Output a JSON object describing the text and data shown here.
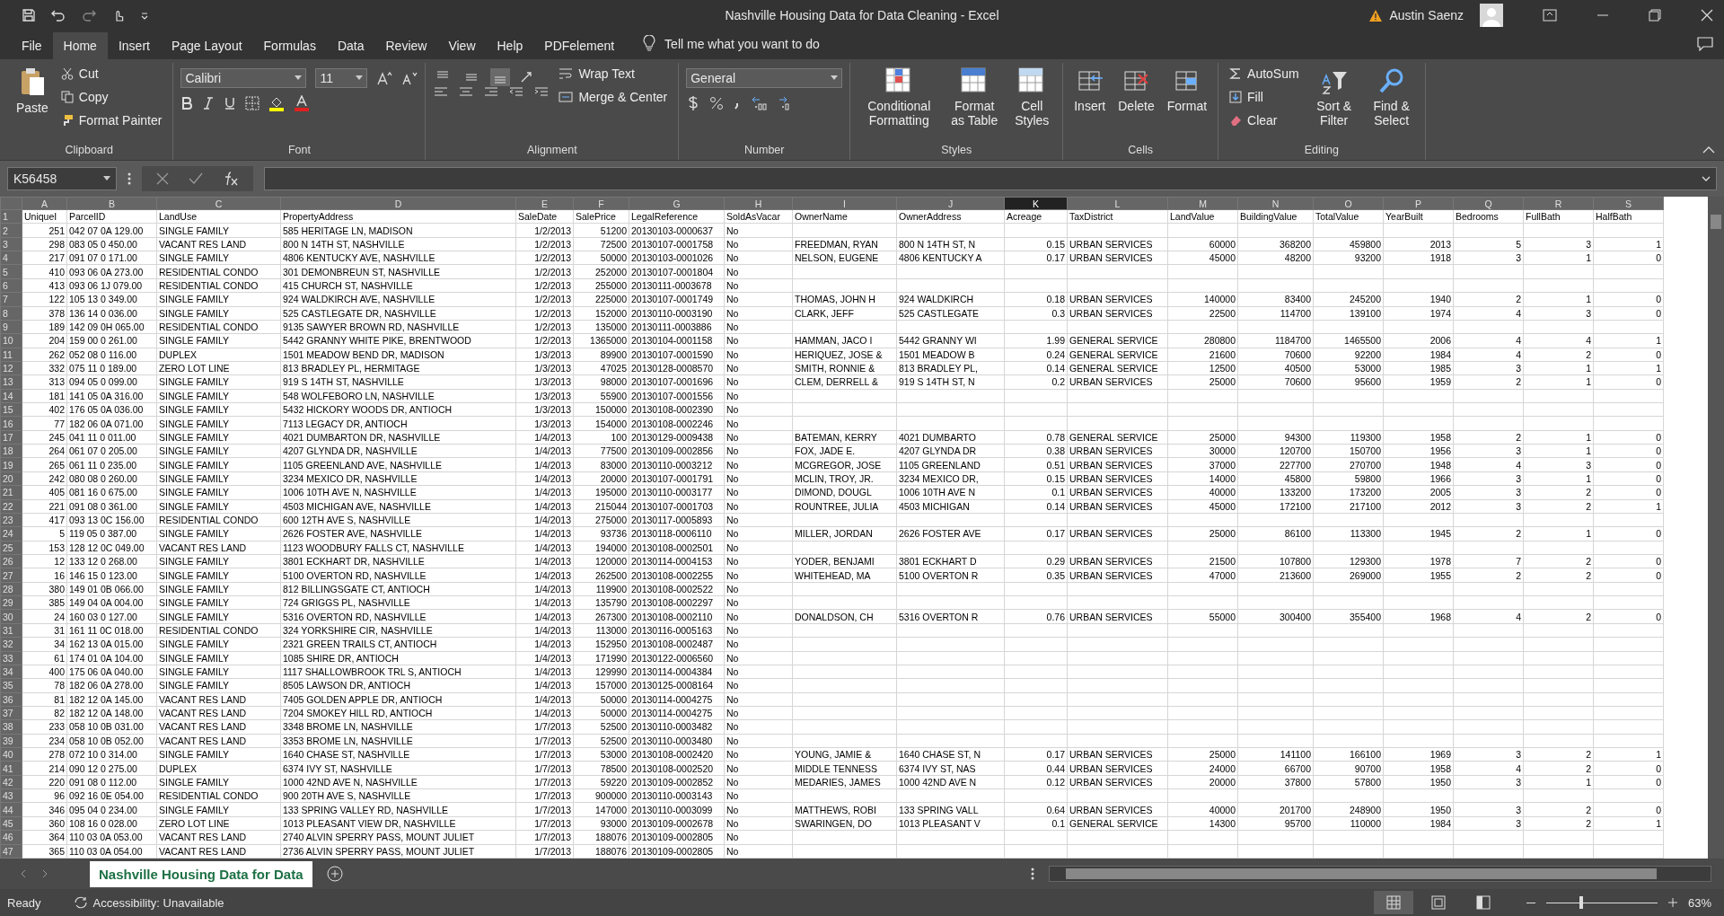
{
  "window": {
    "title": "Nashville Housing Data for Data Cleaning  -  Excel",
    "user": "Austin Saenz"
  },
  "menu_tabs": [
    {
      "label": "File",
      "selected": false
    },
    {
      "label": "Home",
      "selected": true
    },
    {
      "label": "Insert",
      "selected": false
    },
    {
      "label": "Page Layout",
      "selected": false
    },
    {
      "label": "Formulas",
      "selected": false
    },
    {
      "label": "Data",
      "selected": false
    },
    {
      "label": "Review",
      "selected": false
    },
    {
      "label": "View",
      "selected": false
    },
    {
      "label": "Help",
      "selected": false
    },
    {
      "label": "PDFelement",
      "selected": false
    }
  ],
  "tell_me": "Tell me what you want to do",
  "ribbon": {
    "clipboard": {
      "label": "Clipboard",
      "paste": "Paste",
      "cut": "Cut",
      "copy": "Copy",
      "format_painter": "Format Painter"
    },
    "font": {
      "label": "Font",
      "font_name": "Calibri",
      "font_size": "11"
    },
    "alignment": {
      "label": "Alignment",
      "wrap_text": "Wrap Text",
      "merge_center": "Merge & Center",
      "vertical_align": [
        {
          "selected": false
        },
        {
          "selected": false
        },
        {
          "selected": true
        }
      ]
    },
    "number": {
      "label": "Number",
      "format": "General"
    },
    "styles": {
      "label": "Styles",
      "buttons": [
        "Conditional Formatting",
        "Format as Table",
        "Cell Styles"
      ]
    },
    "cells": {
      "label": "Cells",
      "buttons": [
        "Insert",
        "Delete",
        "Format"
      ]
    },
    "editing": {
      "label": "Editing",
      "autosum": "AutoSum",
      "fill": "Fill",
      "clear": "Clear",
      "buttons": [
        "Sort & Filter",
        "Find & Select"
      ]
    }
  },
  "formula_bar": {
    "name_box": "K56458"
  },
  "columns": [
    {
      "letter": "A",
      "selected": false
    },
    {
      "letter": "B",
      "selected": false
    },
    {
      "letter": "C",
      "selected": false
    },
    {
      "letter": "D",
      "selected": false
    },
    {
      "letter": "E",
      "selected": false
    },
    {
      "letter": "F",
      "selected": false
    },
    {
      "letter": "G",
      "selected": false
    },
    {
      "letter": "H",
      "selected": false
    },
    {
      "letter": "I",
      "selected": false
    },
    {
      "letter": "J",
      "selected": false
    },
    {
      "letter": "K",
      "selected": true
    },
    {
      "letter": "L",
      "selected": false
    },
    {
      "letter": "M",
      "selected": false
    },
    {
      "letter": "N",
      "selected": false
    },
    {
      "letter": "O",
      "selected": false
    },
    {
      "letter": "P",
      "selected": false
    },
    {
      "letter": "Q",
      "selected": false
    },
    {
      "letter": "R",
      "selected": false
    },
    {
      "letter": "S",
      "selected": false
    }
  ],
  "rows": [
    {
      "row": "1",
      "cells": [
        "UniqueI",
        "ParcelID",
        "LandUse",
        "PropertyAddress",
        "SaleDate",
        "SalePrice",
        "LegalReference",
        "SoldAsVacar"
      ],
      "owner": [
        "OwnerName",
        "OwnerAddress",
        "Acreage",
        "TaxDistrict",
        "LandValue",
        "BuildingValue",
        "TotalValue",
        "YearBuilt",
        "Bedrooms",
        "FullBath",
        "HalfBath"
      ]
    },
    {
      "row": "2",
      "cells": [
        "251",
        "042 07 0A 129.00",
        "SINGLE FAMILY",
        "585  HERITAGE LN, MADISON",
        "1/2/2013",
        "51200",
        "20130103-0000637",
        "No"
      ]
    },
    {
      "row": "3",
      "cells": [
        "298",
        "083 05 0 450.00",
        "VACANT RES LAND",
        "800  N 14TH ST, NASHVILLE",
        "1/2/2013",
        "72500",
        "20130107-0001758",
        "No"
      ],
      "owner": [
        "FREEDMAN, RYAN",
        "800  N 14TH ST, N",
        "0.15",
        "URBAN SERVICES",
        "60000",
        "368200",
        "459800",
        "2013",
        "5",
        "3",
        "1"
      ]
    },
    {
      "row": "4",
      "cells": [
        "217",
        "091 07 0 171.00",
        "SINGLE FAMILY",
        "4806  KENTUCKY AVE, NASHVILLE",
        "1/2/2013",
        "50000",
        "20130103-0001026",
        "No"
      ],
      "owner": [
        "NELSON, EUGENE",
        "4806  KENTUCKY A",
        "0.17",
        "URBAN SERVICES",
        "45000",
        "48200",
        "93200",
        "1918",
        "3",
        "1",
        "0"
      ]
    },
    {
      "row": "5",
      "cells": [
        "410",
        "093 06 0A 273.00",
        "RESIDENTIAL CONDO",
        "301  DEMONBREUN ST, NASHVILLE",
        "1/2/2013",
        "252000",
        "20130107-0001804",
        "No"
      ]
    },
    {
      "row": "6",
      "cells": [
        "413",
        "093 06 1J 079.00",
        "RESIDENTIAL CONDO",
        "415  CHURCH ST, NASHVILLE",
        "1/2/2013",
        "255000",
        "20130111-0003678",
        "No"
      ]
    },
    {
      "row": "7",
      "cells": [
        "122",
        "105 13 0 349.00",
        "SINGLE FAMILY",
        "924  WALDKIRCH AVE, NASHVILLE",
        "1/2/2013",
        "225000",
        "20130107-0001749",
        "No"
      ],
      "owner": [
        "THOMAS, JOHN H",
        "924  WALDKIRCH",
        "0.18",
        "URBAN SERVICES",
        "140000",
        "83400",
        "245200",
        "1940",
        "2",
        "1",
        "0"
      ]
    },
    {
      "row": "8",
      "cells": [
        "378",
        "136 14 0 036.00",
        "SINGLE FAMILY",
        "525  CASTLEGATE DR, NASHVILLE",
        "1/2/2013",
        "152000",
        "20130110-0003190",
        "No"
      ],
      "owner": [
        "CLARK, JEFF",
        "525  CASTLEGATE",
        "0.3",
        "URBAN SERVICES",
        "22500",
        "114700",
        "139100",
        "1974",
        "4",
        "3",
        "0"
      ]
    },
    {
      "row": "9",
      "cells": [
        "189",
        "142 09 0H 065.00",
        "RESIDENTIAL CONDO",
        "9135  SAWYER BROWN RD, NASHVILLE",
        "1/2/2013",
        "135000",
        "20130111-0003886",
        "No"
      ]
    },
    {
      "row": "10",
      "cells": [
        "204",
        "159 00 0 261.00",
        "SINGLE FAMILY",
        "5442  GRANNY WHITE PIKE, BRENTWOOD",
        "1/2/2013",
        "1365000",
        "20130104-0001158",
        "No"
      ],
      "owner": [
        "HAMMAN, JACO I",
        "5442  GRANNY WI",
        "1.99",
        "GENERAL SERVICE",
        "280800",
        "1184700",
        "1465500",
        "2006",
        "4",
        "4",
        "1"
      ]
    },
    {
      "row": "11",
      "cells": [
        "262",
        "052 08 0 116.00",
        "DUPLEX",
        "1501  MEADOW BEND DR, MADISON",
        "1/3/2013",
        "89900",
        "20130107-0001590",
        "No"
      ],
      "owner": [
        "HERIQUEZ, JOSE &",
        "1501  MEADOW B",
        "0.24",
        "GENERAL SERVICE",
        "21600",
        "70600",
        "92200",
        "1984",
        "4",
        "2",
        "0"
      ]
    },
    {
      "row": "12",
      "cells": [
        "332",
        "075 11 0 189.00",
        "ZERO LOT LINE",
        "813  BRADLEY PL, HERMITAGE",
        "1/3/2013",
        "47025",
        "20130128-0008570",
        "No"
      ],
      "owner": [
        "SMITH, RONNIE &",
        "813  BRADLEY PL,",
        "0.14",
        "GENERAL SERVICE",
        "12500",
        "40500",
        "53000",
        "1985",
        "3",
        "1",
        "1"
      ]
    },
    {
      "row": "13",
      "cells": [
        "313",
        "094 05 0 099.00",
        "SINGLE FAMILY",
        "919  S 14TH ST, NASHVILLE",
        "1/3/2013",
        "98000",
        "20130107-0001696",
        "No"
      ],
      "owner": [
        "CLEM, DERRELL &",
        "919  S 14TH ST, N",
        "0.2",
        "URBAN SERVICES",
        "25000",
        "70600",
        "95600",
        "1959",
        "2",
        "1",
        "0"
      ]
    },
    {
      "row": "14",
      "cells": [
        "181",
        "141 05 0A 316.00",
        "SINGLE FAMILY",
        "548  WOLFEBORO LN, NASHVILLE",
        "1/3/2013",
        "55900",
        "20130107-0001556",
        "No"
      ]
    },
    {
      "row": "15",
      "cells": [
        "402",
        "176 05 0A 036.00",
        "SINGLE FAMILY",
        "5432  HICKORY WOODS DR, ANTIOCH",
        "1/3/2013",
        "150000",
        "20130108-0002390",
        "No"
      ]
    },
    {
      "row": "16",
      "cells": [
        "77",
        "182 06 0A 071.00",
        "SINGLE FAMILY",
        "7113  LEGACY DR, ANTIOCH",
        "1/3/2013",
        "154000",
        "20130108-0002246",
        "No"
      ]
    },
    {
      "row": "17",
      "cells": [
        "245",
        "041 11 0 011.00",
        "SINGLE FAMILY",
        "4021  DUMBARTON DR, NASHVILLE",
        "1/4/2013",
        "100",
        "20130129-0009438",
        "No"
      ],
      "owner": [
        "BATEMAN, KERRY",
        "4021  DUMBARTO",
        "0.78",
        "GENERAL SERVICE",
        "25000",
        "94300",
        "119300",
        "1958",
        "2",
        "1",
        "0"
      ]
    },
    {
      "row": "18",
      "cells": [
        "264",
        "061 07 0 205.00",
        "SINGLE FAMILY",
        "4207  GLYNDA DR, NASHVILLE",
        "1/4/2013",
        "77500",
        "20130109-0002856",
        "No"
      ],
      "owner": [
        "FOX, JADE E.",
        "4207  GLYNDA DR",
        "0.38",
        "URBAN SERVICES",
        "30000",
        "120700",
        "150700",
        "1956",
        "3",
        "1",
        "0"
      ]
    },
    {
      "row": "19",
      "cells": [
        "265",
        "061 11 0 235.00",
        "SINGLE FAMILY",
        "1105  GREENLAND AVE, NASHVILLE",
        "1/4/2013",
        "83000",
        "20130110-0003212",
        "No"
      ],
      "owner": [
        "MCGREGOR, JOSE",
        "1105  GREENLAND",
        "0.51",
        "URBAN SERVICES",
        "37000",
        "227700",
        "270700",
        "1948",
        "4",
        "3",
        "0"
      ]
    },
    {
      "row": "20",
      "cells": [
        "242",
        "080 08 0 260.00",
        "SINGLE FAMILY",
        "3234  MEXICO DR, NASHVILLE",
        "1/4/2013",
        "20000",
        "20130107-0001791",
        "No"
      ],
      "owner": [
        "MCLIN, TROY, JR.",
        "3234  MEXICO DR,",
        "0.15",
        "URBAN SERVICES",
        "14000",
        "45800",
        "59800",
        "1966",
        "3",
        "1",
        "0"
      ]
    },
    {
      "row": "21",
      "cells": [
        "405",
        "081 16 0 675.00",
        "SINGLE FAMILY",
        "1006  10TH AVE N, NASHVILLE",
        "1/4/2013",
        "195000",
        "20130110-0003177",
        "No"
      ],
      "owner": [
        "DIMOND, DOUGL",
        "1006  10TH AVE N",
        "0.1",
        "URBAN SERVICES",
        "40000",
        "133200",
        "173200",
        "2005",
        "3",
        "2",
        "0"
      ]
    },
    {
      "row": "22",
      "cells": [
        "221",
        "091 08 0 361.00",
        "SINGLE FAMILY",
        "4503  MICHIGAN AVE, NASHVILLE",
        "1/4/2013",
        "215044",
        "20130107-0001703",
        "No"
      ],
      "owner": [
        "ROUNTREE, JULIA",
        "4503  MICHIGAN",
        "0.14",
        "URBAN SERVICES",
        "45000",
        "172100",
        "217100",
        "2012",
        "3",
        "2",
        "1"
      ]
    },
    {
      "row": "23",
      "cells": [
        "417",
        "093 13 0C 156.00",
        "RESIDENTIAL CONDO",
        "600  12TH AVE S, NASHVILLE",
        "1/4/2013",
        "275000",
        "20130117-0005893",
        "No"
      ]
    },
    {
      "row": "24",
      "cells": [
        "5",
        "119 05 0 387.00",
        "SINGLE FAMILY",
        "2626  FOSTER AVE, NASHVILLE",
        "1/4/2013",
        "93736",
        "20130118-0006110",
        "No"
      ],
      "owner": [
        "MILLER, JORDAN",
        "2626  FOSTER AVE",
        "0.17",
        "URBAN SERVICES",
        "25000",
        "86100",
        "113300",
        "1945",
        "2",
        "1",
        "0"
      ]
    },
    {
      "row": "25",
      "cells": [
        "153",
        "128 12 0C 049.00",
        "VACANT RES LAND",
        "1123  WOODBURY FALLS CT, NASHVILLE",
        "1/4/2013",
        "194000",
        "20130108-0002501",
        "No"
      ]
    },
    {
      "row": "26",
      "cells": [
        "12",
        "133 12 0 268.00",
        "SINGLE FAMILY",
        "3801  ECKHART DR, NASHVILLE",
        "1/4/2013",
        "120000",
        "20130114-0004153",
        "No"
      ],
      "owner": [
        "YODER, BENJAMI",
        "3801  ECKHART D",
        "0.29",
        "URBAN SERVICES",
        "21500",
        "107800",
        "129300",
        "1978",
        "7",
        "2",
        "0"
      ]
    },
    {
      "row": "27",
      "cells": [
        "16",
        "146 15 0 123.00",
        "SINGLE FAMILY",
        "5100  OVERTON RD, NASHVILLE",
        "1/4/2013",
        "262500",
        "20130108-0002255",
        "No"
      ],
      "owner": [
        "WHITEHEAD, MA",
        "5100  OVERTON R",
        "0.35",
        "URBAN SERVICES",
        "47000",
        "213600",
        "269000",
        "1955",
        "2",
        "2",
        "0"
      ]
    },
    {
      "row": "28",
      "cells": [
        "380",
        "149 01 0B 066.00",
        "SINGLE FAMILY",
        "812  BILLINGSGATE CT, ANTIOCH",
        "1/4/2013",
        "119900",
        "20130108-0002522",
        "No"
      ]
    },
    {
      "row": "29",
      "cells": [
        "385",
        "149 04 0A 004.00",
        "SINGLE FAMILY",
        "724  GRIGGS PL, NASHVILLE",
        "1/4/2013",
        "135790",
        "20130108-0002297",
        "No"
      ]
    },
    {
      "row": "30",
      "cells": [
        "24",
        "160 03 0 127.00",
        "SINGLE FAMILY",
        "5316  OVERTON RD, NASHVILLE",
        "1/4/2013",
        "267300",
        "20130108-0002110",
        "No"
      ],
      "owner": [
        "DONALDSON, CH",
        "5316  OVERTON R",
        "0.76",
        "URBAN SERVICES",
        "55000",
        "300400",
        "355400",
        "1968",
        "4",
        "2",
        "0"
      ]
    },
    {
      "row": "31",
      "cells": [
        "31",
        "161 11 0C 018.00",
        "RESIDENTIAL CONDO",
        "324  YORKSHIRE CIR, NASHVILLE",
        "1/4/2013",
        "113000",
        "20130116-0005163",
        "No"
      ]
    },
    {
      "row": "32",
      "cells": [
        "34",
        "162 13 0A 015.00",
        "SINGLE FAMILY",
        "2321  GREEN TRAILS CT, ANTIOCH",
        "1/4/2013",
        "152950",
        "20130108-0002487",
        "No"
      ]
    },
    {
      "row": "33",
      "cells": [
        "61",
        "174 01 0A 104.00",
        "SINGLE FAMILY",
        "1085  SHIRE DR, ANTIOCH",
        "1/4/2013",
        "171990",
        "20130122-0006560",
        "No"
      ]
    },
    {
      "row": "34",
      "cells": [
        "400",
        "175 06 0A 040.00",
        "SINGLE FAMILY",
        "1117  SHALLOWBROOK TRL S, ANTIOCH",
        "1/4/2013",
        "129990",
        "20130114-0004384",
        "No"
      ]
    },
    {
      "row": "35",
      "cells": [
        "78",
        "182 06 0A 278.00",
        "SINGLE FAMILY",
        "8505  LAWSON DR, ANTIOCH",
        "1/4/2013",
        "157000",
        "20130125-0008164",
        "No"
      ]
    },
    {
      "row": "36",
      "cells": [
        "81",
        "182 12 0A 145.00",
        "VACANT RES LAND",
        "7405  GOLDEN APPLE DR, ANTIOCH",
        "1/4/2013",
        "50000",
        "20130114-0004275",
        "No"
      ]
    },
    {
      "row": "37",
      "cells": [
        "82",
        "182 12 0A 148.00",
        "VACANT RES LAND",
        "7204  SMOKEY HILL RD, ANTIOCH",
        "1/4/2013",
        "50000",
        "20130114-0004275",
        "No"
      ]
    },
    {
      "row": "38",
      "cells": [
        "233",
        "058 10 0B 031.00",
        "VACANT RES LAND",
        "3348  BROME LN, NASHVILLE",
        "1/7/2013",
        "52500",
        "20130110-0003482",
        "No"
      ]
    },
    {
      "row": "39",
      "cells": [
        "234",
        "058 10 0B 052.00",
        "VACANT RES LAND",
        "3353  BROME LN, NASHVILLE",
        "1/7/2013",
        "52500",
        "20130110-0003480",
        "No"
      ]
    },
    {
      "row": "40",
      "cells": [
        "278",
        "072 10 0 314.00",
        "SINGLE FAMILY",
        "1640  CHASE ST, NASHVILLE",
        "1/7/2013",
        "53000",
        "20130108-0002420",
        "No"
      ],
      "owner": [
        "YOUNG, JAMIE &",
        "1640  CHASE ST, N",
        "0.17",
        "URBAN SERVICES",
        "25000",
        "141100",
        "166100",
        "1969",
        "3",
        "2",
        "1"
      ]
    },
    {
      "row": "41",
      "cells": [
        "214",
        "090 12 0 275.00",
        "DUPLEX",
        "6374  IVY ST, NASHVILLE",
        "1/7/2013",
        "78500",
        "20130108-0002520",
        "No"
      ],
      "owner": [
        "MIDDLE TENNESS",
        "6374  IVY ST, NAS",
        "0.44",
        "URBAN SERVICES",
        "24000",
        "66700",
        "90700",
        "1958",
        "4",
        "2",
        "0"
      ]
    },
    {
      "row": "42",
      "cells": [
        "220",
        "091 08 0 112.00",
        "SINGLE FAMILY",
        "1000  42ND AVE N, NASHVILLE",
        "1/7/2013",
        "59220",
        "20130109-0002852",
        "No"
      ],
      "owner": [
        "MEDARIES, JAMES",
        "1000  42ND AVE N",
        "0.12",
        "URBAN SERVICES",
        "20000",
        "37800",
        "57800",
        "1950",
        "3",
        "1",
        "0"
      ]
    },
    {
      "row": "43",
      "cells": [
        "96",
        "092 16 0E 054.00",
        "RESIDENTIAL CONDO",
        "900  20TH AVE S, NASHVILLE",
        "1/7/2013",
        "900000",
        "20130110-0003143",
        "No"
      ]
    },
    {
      "row": "44",
      "cells": [
        "346",
        "095 04 0 234.00",
        "SINGLE FAMILY",
        "133  SPRING VALLEY RD, NASHVILLE",
        "1/7/2013",
        "147000",
        "20130110-0003099",
        "No"
      ],
      "owner": [
        "MATTHEWS, ROBI",
        "133  SPRING VALL",
        "0.64",
        "URBAN SERVICES",
        "40000",
        "201700",
        "248900",
        "1950",
        "3",
        "2",
        "0"
      ]
    },
    {
      "row": "45",
      "cells": [
        "360",
        "108 16 0 028.00",
        "ZERO LOT LINE",
        "1013  PLEASANT VIEW DR, NASHVILLE",
        "1/7/2013",
        "93000",
        "20130109-0002678",
        "No"
      ],
      "owner": [
        "SWARINGEN, DO",
        "1013  PLEASANT V",
        "0.1",
        "GENERAL SERVICE",
        "14300",
        "95700",
        "110000",
        "1984",
        "3",
        "2",
        "1"
      ]
    },
    {
      "row": "46",
      "cells": [
        "364",
        "110 03 0A 053.00",
        "VACANT RES LAND",
        "2740  ALVIN SPERRY PASS, MOUNT JULIET",
        "1/7/2013",
        "188076",
        "20130109-0002805",
        "No"
      ]
    },
    {
      "row": "47",
      "cells": [
        "365",
        "110 03 0A 054.00",
        "VACANT RES LAND",
        "2736  ALVIN SPERRY PASS, MOUNT JULIET",
        "1/7/2013",
        "188076",
        "20130109-0002805",
        "No"
      ]
    }
  ],
  "sheet_tabs": [
    {
      "label": "Nashville Housing Data for Data",
      "selected": true
    }
  ],
  "status_bar": {
    "status": "Ready",
    "accessibility": "Accessibility: Unavailable",
    "views": [
      {
        "selected": true
      },
      {
        "selected": false
      },
      {
        "selected": false
      }
    ],
    "zoom": {
      "reading": "63%",
      "level": 0.3
    }
  }
}
